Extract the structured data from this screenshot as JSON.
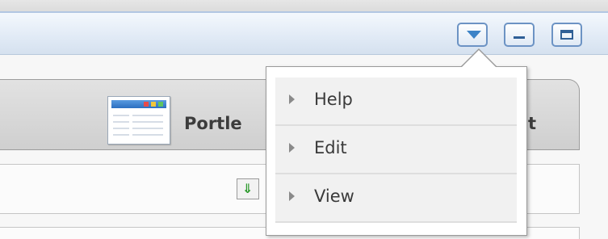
{
  "window": {
    "menu_button_icon": "dropdown-triangle-icon",
    "minimize_icon": "minimize-icon",
    "maximize_icon": "maximize-icon"
  },
  "tab": {
    "label_start": "Portle",
    "label_end": "t",
    "icon": "portlet-window-icon"
  },
  "toolbar": {
    "icon": "download-arrow-icon"
  },
  "menu": {
    "items": [
      {
        "label": "Help"
      },
      {
        "label": "Edit"
      },
      {
        "label": "View"
      }
    ]
  },
  "colors": {
    "accent": "#3d83c7",
    "button_border": "#6c93c4"
  }
}
